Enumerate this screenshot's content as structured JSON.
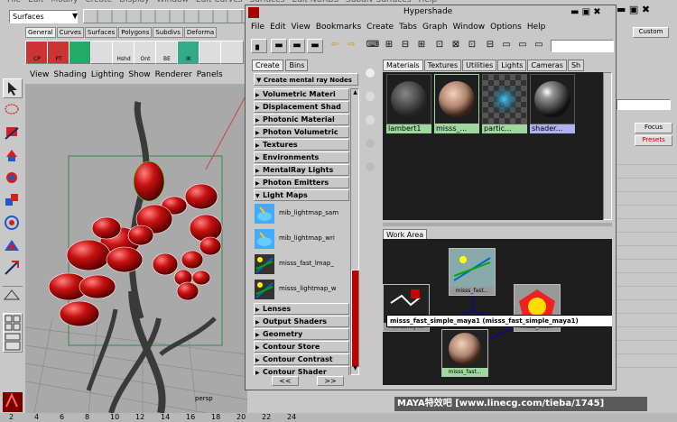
{
  "main_menu": [
    "File",
    "Edit",
    "Modify",
    "Create",
    "Display",
    "Window",
    "Edit Curves",
    "Surfaces",
    "Edit NURBS",
    "Subdiv Surfaces",
    "Help"
  ],
  "menu_set": "Surfaces",
  "shelf_tabs": [
    "General",
    "Curves",
    "Surfaces",
    "Polygons",
    "Subdivs",
    "Deforma"
  ],
  "shelf_icons": [
    "CP",
    "PT",
    "",
    "",
    "Hshd",
    "Ont",
    "BE",
    "IK",
    "",
    ""
  ],
  "viewport": {
    "menus": [
      "View",
      "Shading",
      "Lighting",
      "Show",
      "Renderer",
      "Panels"
    ],
    "camera_label": "persp"
  },
  "hypershade": {
    "title": "Hypershade",
    "menus": [
      "File",
      "Edit",
      "View",
      "Bookmarks",
      "Create",
      "Tabs",
      "Graph",
      "Window",
      "Options",
      "Help"
    ],
    "left_tabs": [
      "Create",
      "Bins"
    ],
    "create_header": "Create mental ray Nodes",
    "sections_top": [
      "Volumetric Materi",
      "Displacement Shad",
      "Photonic Material",
      "Photon Volumetric",
      "Textures",
      "Environments",
      "MentalRay Lights",
      "Photon Emitters",
      "Light Maps"
    ],
    "lightmap_items": [
      "mib_lightmap_sam",
      "mib_lightmap_wri",
      "misss_fast_lmap_",
      "misss_lightmap_w"
    ],
    "sections_bottom": [
      "Lenses",
      "Output Shaders",
      "Geometry",
      "Contour Store",
      "Contour Contrast",
      "Contour Shader"
    ],
    "pager": [
      "<<",
      ">>"
    ],
    "mat_tabs": [
      "Materials",
      "Textures",
      "Utilities",
      "Lights",
      "Cameras",
      "Sh"
    ],
    "swatches": [
      {
        "name": "lambert1",
        "label_color": "#9fd89f"
      },
      {
        "name": "misss_...",
        "label_color": "#9fd89f"
      },
      {
        "name": "partic...",
        "label_color": "#9fd89f"
      },
      {
        "name": "shader...",
        "label_color": "#9fd89f"
      }
    ],
    "work_area_tab": "Work Area",
    "nodes": [
      {
        "label": "misss_fast..."
      },
      {
        "label": "misss_fast..."
      },
      {
        "label": "mentalrayT..."
      },
      {
        "label": "misss_fast..."
      }
    ],
    "tooltip": "misss_fast_simple_maya1 (misss_fast_simple_maya1)"
  },
  "right_panel": {
    "focus_label": "Focus",
    "presets_label": "Presets",
    "custom_label": "Custom"
  },
  "timeline": [
    "2",
    "4",
    "6",
    "8",
    "10",
    "12",
    "14",
    "16",
    "18",
    "20",
    "22",
    "24"
  ],
  "watermark": "MAYA特效吧 [www.linecg.com/tieba/1745]"
}
